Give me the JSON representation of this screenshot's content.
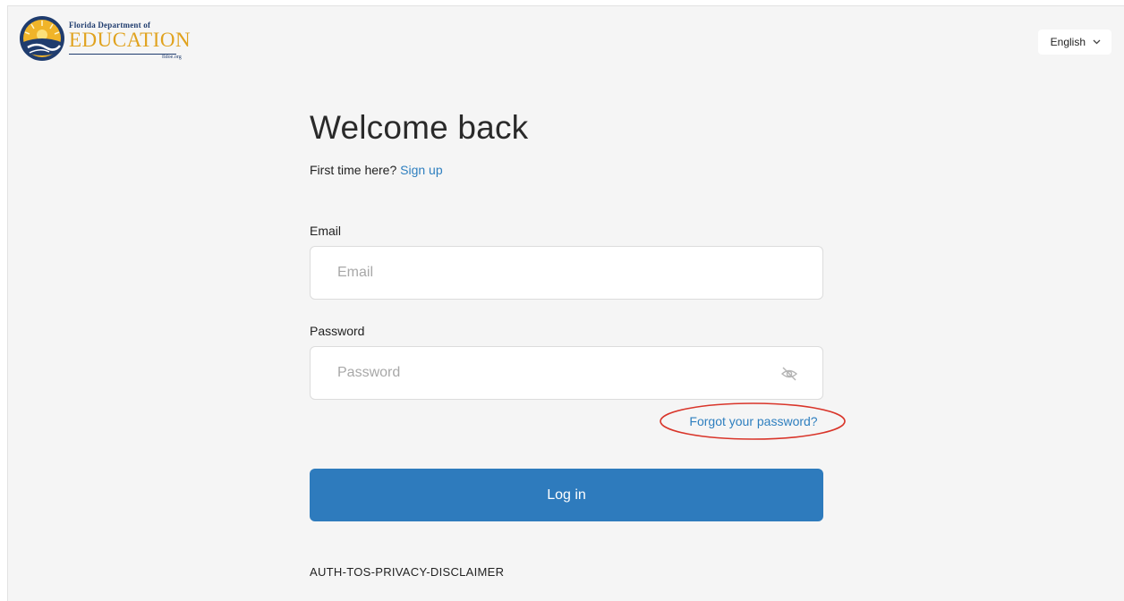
{
  "header": {
    "logo": {
      "line1": "Florida Department of",
      "line2": "EDUCATION",
      "url": "fldoe.org"
    },
    "language": {
      "selected": "English",
      "icon": "chevron-down-icon"
    }
  },
  "form": {
    "title": "Welcome back",
    "signup_prompt": "First time here?",
    "signup_link": "Sign up",
    "email": {
      "label": "Email",
      "placeholder": "Email",
      "value": ""
    },
    "password": {
      "label": "Password",
      "placeholder": "Password",
      "value": "",
      "toggle_icon": "eye-slash-icon"
    },
    "forgot_link": "Forgot your password?",
    "login_button": "Log in",
    "disclaimer": "AUTH-TOS-PRIVACY-DISCLAIMER"
  },
  "colors": {
    "accent": "#2e7bbd",
    "link": "#2e7fbf",
    "annotation": "#d9352a",
    "background": "#f5f5f5"
  }
}
